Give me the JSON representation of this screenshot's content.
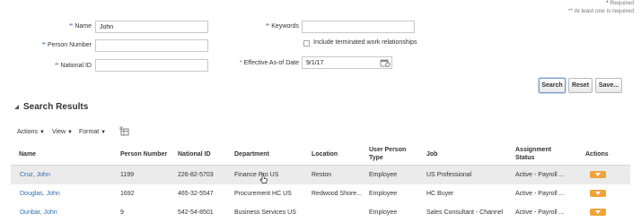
{
  "required_note": {
    "star": "*",
    "required": "Required",
    "at_least_one": "** At least one is required"
  },
  "form": {
    "name": {
      "stars": "**",
      "label": "Name",
      "value": "John"
    },
    "person_number": {
      "stars": "**",
      "label": "Person Number",
      "value": ""
    },
    "national_id": {
      "stars": "**",
      "label": "National ID",
      "value": ""
    },
    "keywords": {
      "stars": "**",
      "label": "Keywords",
      "value": ""
    },
    "include_terminated": {
      "label": "Include terminated work relationships",
      "checked": false
    },
    "effective_date": {
      "stars": "*",
      "label": "Effective As-of Date",
      "value": "9/1/17"
    }
  },
  "buttons": {
    "search": "Search",
    "reset": "Reset",
    "save": "Save..."
  },
  "results": {
    "title": "Search Results",
    "toolbar": {
      "actions": "Actions",
      "view": "View",
      "format": "Format"
    },
    "columns": [
      "Name",
      "Person Number",
      "National ID",
      "Department",
      "Location",
      "User Person Type",
      "Job",
      "Assignment Status",
      "Actions"
    ],
    "rows": [
      {
        "name": "Cruz, John",
        "person_number": "1199",
        "national_id": "226-82-5703",
        "department": "Finance Pro US",
        "location": "Reston",
        "user_person_type": "Employee",
        "job": "US Professional",
        "assignment_status": "Active - Payroll ..."
      },
      {
        "name": "Douglas, John",
        "person_number": "1692",
        "national_id": "465-32-5547",
        "department": "Procurement HC US",
        "location": "Redwood Shore...",
        "user_person_type": "Employee",
        "job": "HC Buyer",
        "assignment_status": "Active - Payroll ..."
      },
      {
        "name": "Dunbar, John",
        "person_number": "9",
        "national_id": "542-54-8501",
        "department": "Business Services US",
        "location": "",
        "user_person_type": "Employee",
        "job": "Sales Consultant - Channel",
        "assignment_status": "Active - Payroll ..."
      }
    ]
  },
  "icons": {
    "calendar": "calendar-icon",
    "detach": "detach-table-icon",
    "collapse": "collapse-triangle-icon",
    "row_action": "row-actions-menu-icon"
  },
  "colors": {
    "link": "#2f6db3",
    "action_button": "#f0a33b",
    "selected_row": "#ebebeb"
  }
}
